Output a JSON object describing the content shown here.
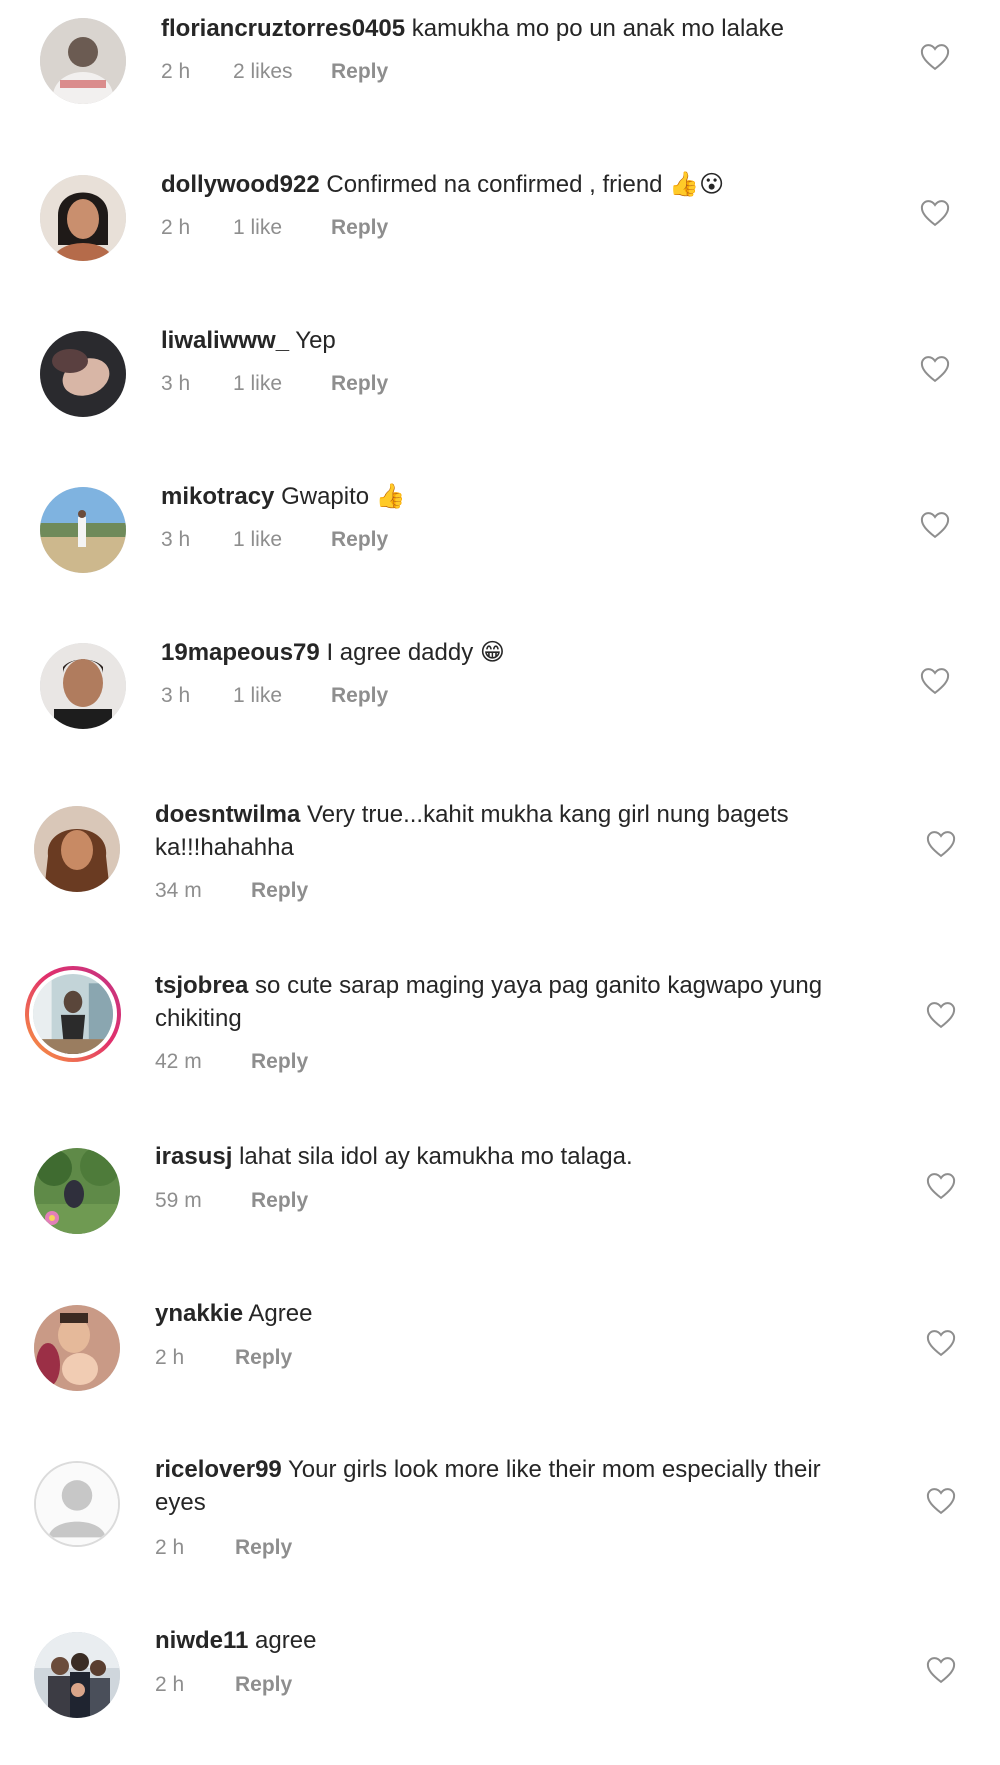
{
  "comments": [
    {
      "username": "floriancruztorres0405",
      "text": "kamukha mo po un anak mo lalake",
      "time": "2 h",
      "likes": "2 likes",
      "reply": "Reply",
      "emoji": ""
    },
    {
      "username": "dollywood922",
      "text": "Confirmed na confirmed , friend",
      "time": "2 h",
      "likes": "1 like",
      "reply": "Reply",
      "emoji": "👍😮"
    },
    {
      "username": "liwaliwww_",
      "text": "Yep",
      "time": "3 h",
      "likes": "1 like",
      "reply": "Reply",
      "emoji": ""
    },
    {
      "username": "mikotracy",
      "text": "Gwapito",
      "time": "3 h",
      "likes": "1 like",
      "reply": "Reply",
      "emoji": "👍"
    },
    {
      "username": "19mapeous79",
      "text": "I agree daddy",
      "time": "3 h",
      "likes": "1 like",
      "reply": "Reply",
      "emoji": "😁"
    },
    {
      "username": "doesntwilma",
      "text": "Very true...kahit mukha kang girl nung bagets ka!!!hahahha",
      "time": "34 m",
      "likes": "",
      "reply": "Reply",
      "emoji": ""
    },
    {
      "username": "tsjobrea",
      "text": "so cute sarap maging yaya pag ganito kagwapo yung chikiting",
      "time": "42 m",
      "likes": "",
      "reply": "Reply",
      "emoji": ""
    },
    {
      "username": "irasusj",
      "text": "lahat sila idol ay kamukha mo talaga.",
      "time": "59 m",
      "likes": "",
      "reply": "Reply",
      "emoji": ""
    },
    {
      "username": "ynakkie",
      "text": "Agree",
      "time": "2 h",
      "likes": "",
      "reply": "Reply",
      "emoji": ""
    },
    {
      "username": "ricelover99",
      "text": "Your girls look more like their mom especially their eyes",
      "time": "2 h",
      "likes": "",
      "reply": "Reply",
      "emoji": ""
    },
    {
      "username": "niwde11",
      "text": "agree",
      "time": "2 h",
      "likes": "",
      "reply": "Reply",
      "emoji": ""
    }
  ],
  "icons": {
    "like": "heart-outline-icon"
  },
  "colors": {
    "text": "#262626",
    "meta": "#8e8e8e",
    "story_ring_start": "#f9a03c",
    "story_ring_end": "#c13584"
  }
}
